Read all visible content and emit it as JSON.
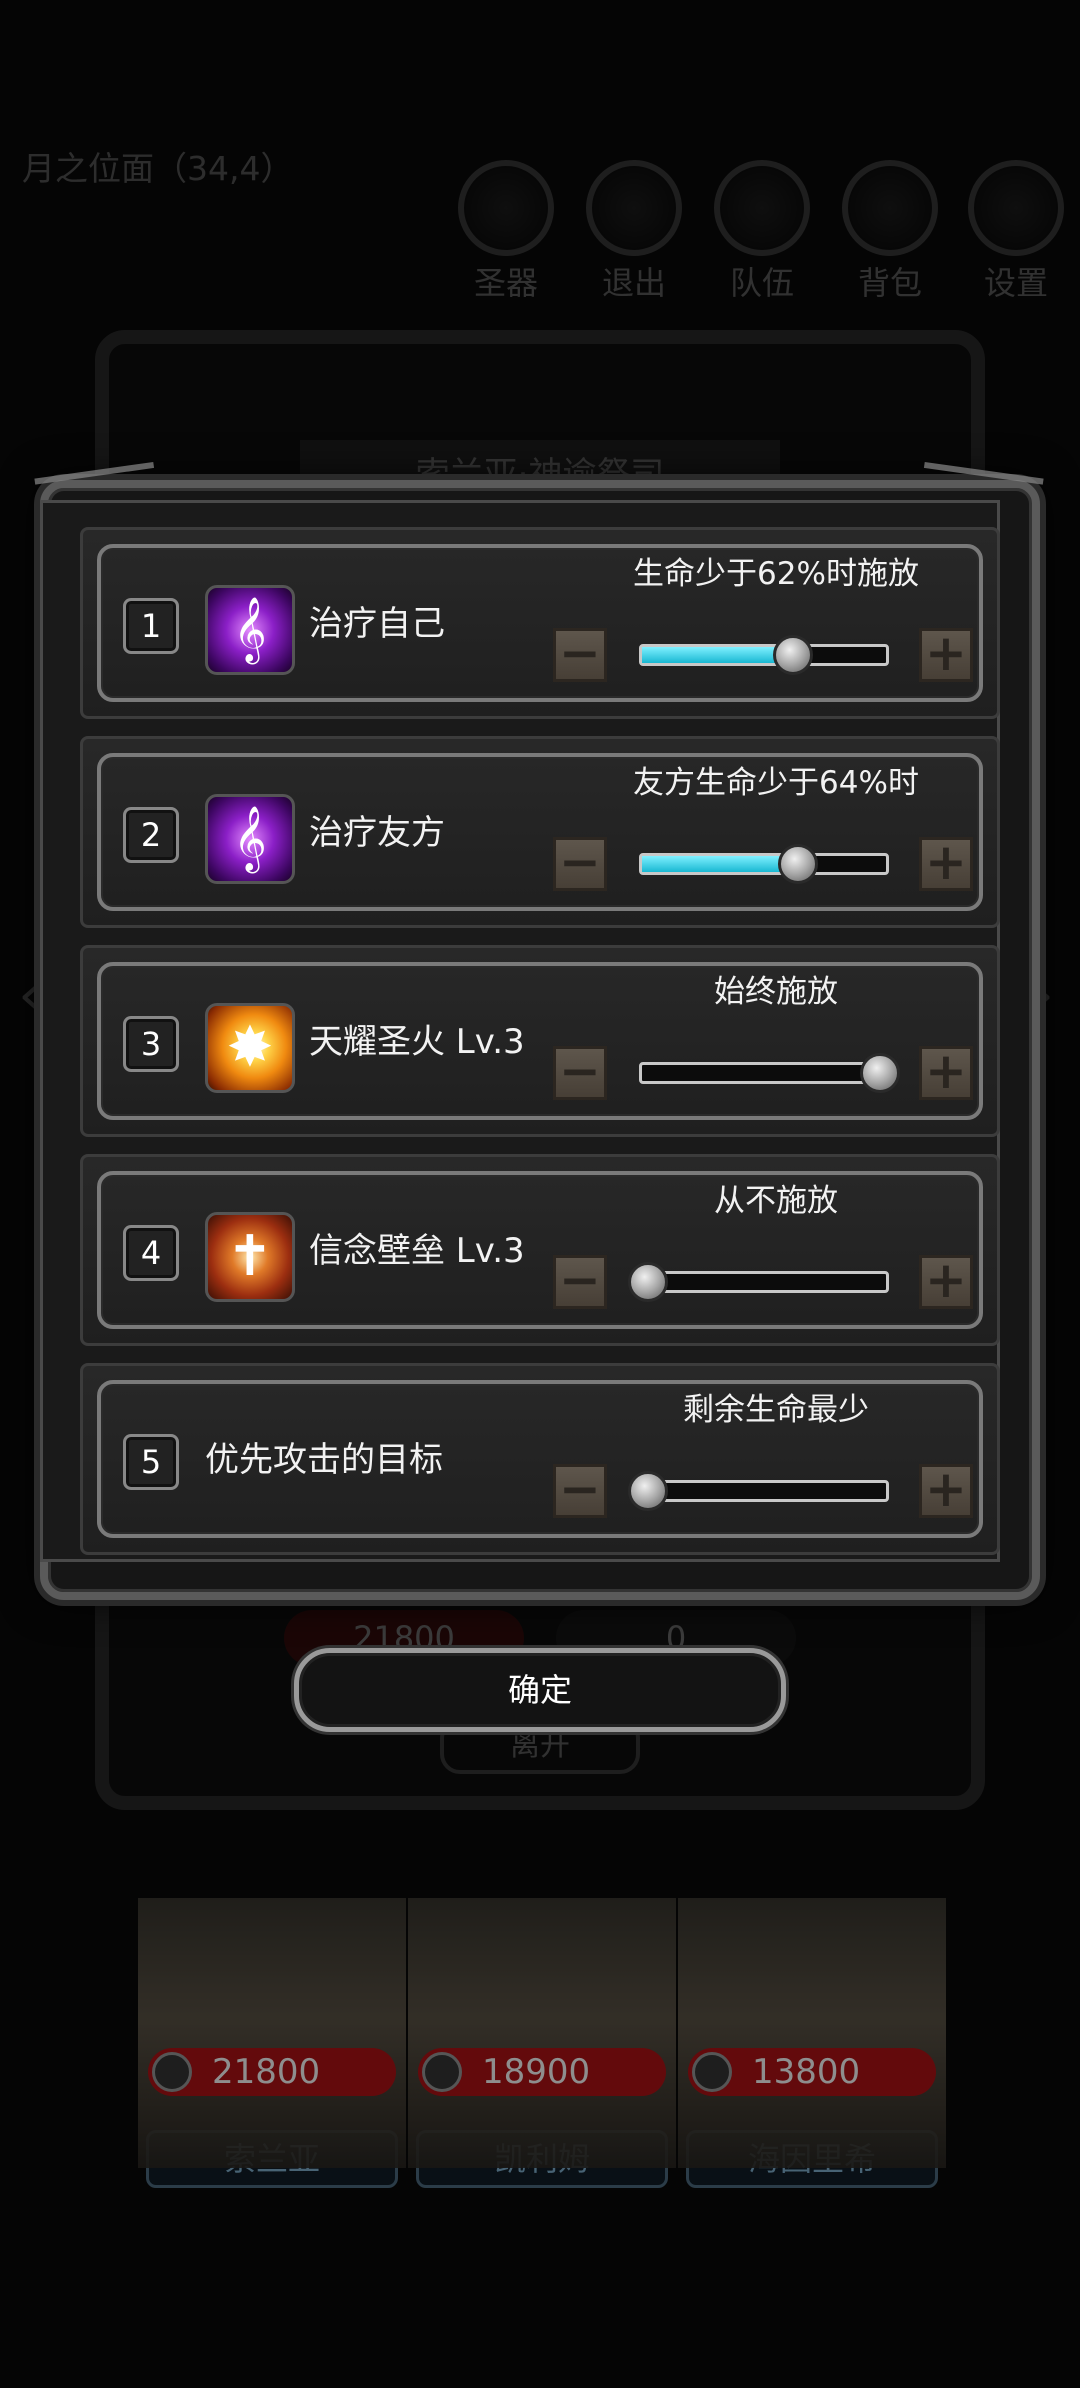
{
  "background": {
    "location": "月之位面（34,4）",
    "menu": [
      "圣器",
      "退出",
      "队伍",
      "背包",
      "设置"
    ],
    "title": "索兰亚·神谕祭司",
    "stats": [
      "21800",
      "0"
    ],
    "open_label": "离开",
    "heroes": [
      {
        "hp": "21800",
        "name": "索兰亚"
      },
      {
        "hp": "18900",
        "name": "凯利姆"
      },
      {
        "hp": "13800",
        "name": "海因里希"
      }
    ]
  },
  "dialog": {
    "rows": [
      {
        "num": "1",
        "icon": "heal-skill-icon",
        "name": "治疗自己",
        "condition": "生命少于62%时施放",
        "level": 0.62
      },
      {
        "num": "2",
        "icon": "heal-skill-icon",
        "name": "治疗友方",
        "condition": "友方生命少于64%时",
        "level": 0.64
      },
      {
        "num": "3",
        "icon": "holy-fire-skill-icon",
        "name": "天耀圣火 Lv.3",
        "condition": "始终施放",
        "level": 1.0
      },
      {
        "num": "4",
        "icon": "faith-bulwark-skill-icon",
        "name": "信念壁垒 Lv.3",
        "condition": "从不施放",
        "level": 0.0
      },
      {
        "num": "5",
        "icon": "",
        "name": "优先攻击的目标",
        "condition": "剩余生命最少",
        "level": 0.0
      }
    ],
    "confirm_label": "确定"
  },
  "colors": {
    "fill": "#19b8d2",
    "hp_bar": "#b10f12"
  }
}
